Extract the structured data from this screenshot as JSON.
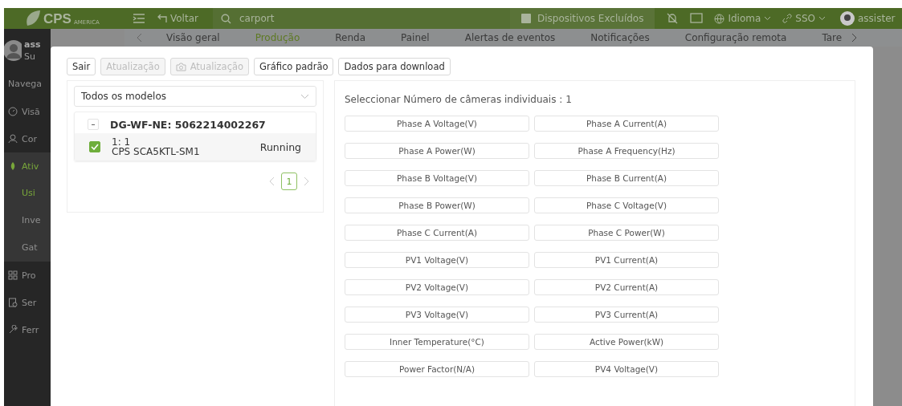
{
  "header": {
    "logo": "CPS",
    "logo_sub": "AMERICA",
    "back": "Voltar",
    "search_value": "carport",
    "excluded": "Dispositivos Excluídos",
    "language": "Idioma",
    "sso": "SSO",
    "user": "assister"
  },
  "tabs": [
    {
      "label": "Visão geral",
      "selected": false
    },
    {
      "label": "Produção",
      "selected": true
    },
    {
      "label": "Renda",
      "selected": false
    },
    {
      "label": "Painel",
      "selected": false
    },
    {
      "label": "Alertas de eventos",
      "selected": false
    },
    {
      "label": "Notificações",
      "selected": false
    },
    {
      "label": "Configuração remota",
      "selected": false
    },
    {
      "label": "Tare",
      "selected": false
    }
  ],
  "sidebar": {
    "user": {
      "name": "ass",
      "role": "Su"
    },
    "items": [
      {
        "label": "Navega",
        "kind": "heading"
      },
      {
        "label": "Visã",
        "kind": "link",
        "selected": false
      },
      {
        "label": "Cor",
        "kind": "link",
        "selected": false
      },
      {
        "label": "Ativ",
        "kind": "link",
        "selected": true,
        "expanded": true,
        "children": [
          {
            "label": "Usi",
            "selected": true
          },
          {
            "label": "Inve",
            "selected": false
          },
          {
            "label": "Gat",
            "selected": false
          }
        ]
      },
      {
        "label": "Pro",
        "kind": "link",
        "selected": false
      },
      {
        "label": "Ser",
        "kind": "link",
        "selected": false
      },
      {
        "label": "Ferr",
        "kind": "link",
        "selected": false
      }
    ]
  },
  "toolbar": [
    {
      "label": "Sair",
      "disabled": false,
      "kind": "plain"
    },
    {
      "label": "Atualização",
      "disabled": true,
      "kind": "plain"
    },
    {
      "label": "Atualização",
      "disabled": true,
      "kind": "camera"
    },
    {
      "label": "Gráfico padrão",
      "disabled": false,
      "kind": "plain"
    },
    {
      "label": "Dados para download",
      "disabled": false,
      "kind": "plain"
    }
  ],
  "device_panel": {
    "model_select": "Todos os modelos",
    "tree": {
      "label": "DG-WF-NE: 5062214002267",
      "expanded": true,
      "children": [
        {
          "line1": "1: 1",
          "line2": "CPS SCA5KTL-SM1",
          "status": "Running",
          "checked": true
        }
      ]
    },
    "pages": [
      {
        "label": "1",
        "selected": true
      }
    ]
  },
  "points_panel": {
    "title": "Seleccionar Número de câmeras individuais : 1",
    "points": [
      "Phase A Voltage(V)",
      "Phase A Current(A)",
      "Phase A Power(W)",
      "Phase A Frequency(Hz)",
      "Phase B Voltage(V)",
      "Phase B Current(A)",
      "Phase B Power(W)",
      "Phase C Voltage(V)",
      "Phase C Current(A)",
      "Phase C Power(W)",
      "PV1 Voltage(V)",
      "PV1 Current(A)",
      "PV2 Voltage(V)",
      "PV2 Current(A)",
      "PV3 Voltage(V)",
      "PV3 Current(A)",
      "Inner Temperature(°C)",
      "Active Power(kW)",
      "Power Factor(N/A)",
      "PV4 Voltage(V)"
    ]
  }
}
